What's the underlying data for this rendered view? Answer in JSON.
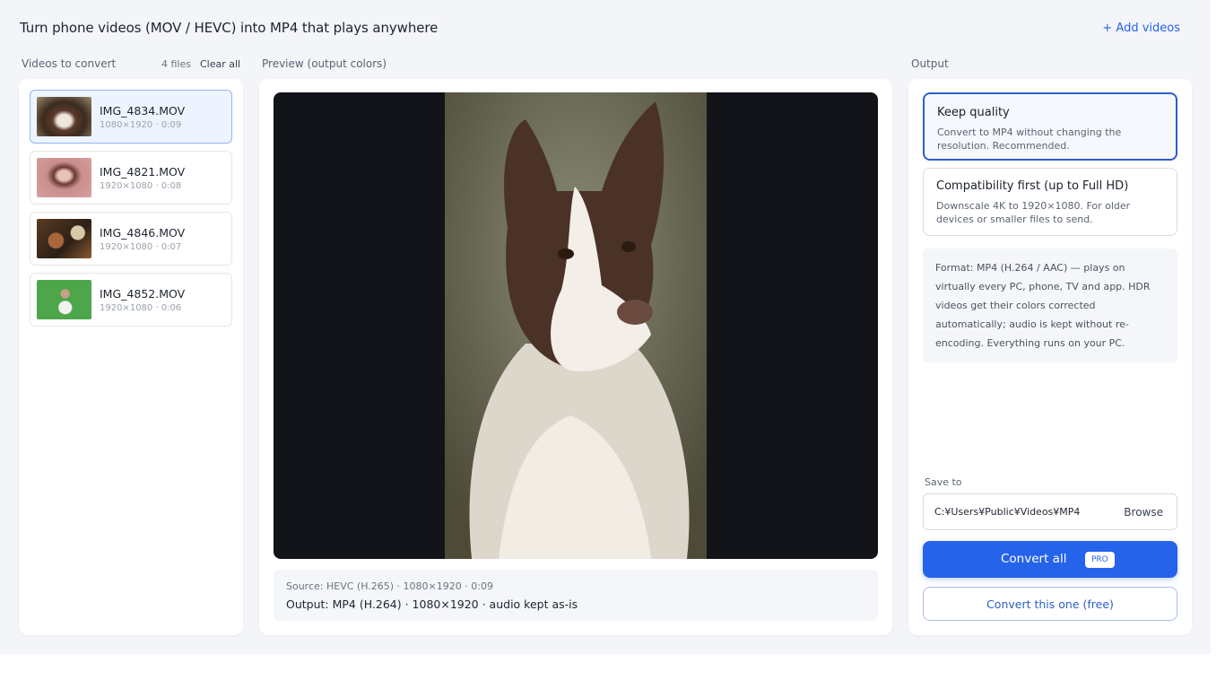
{
  "header": {
    "title": "Turn phone videos (MOV / HEVC) into MP4 that plays anywhere",
    "add_videos": "+ Add videos"
  },
  "videos": {
    "section_label": "Videos to convert",
    "count": "4 files",
    "clear_all": "Clear all",
    "items": [
      {
        "name": "IMG_4834.MOV",
        "meta": "1080×1920 · 0:09",
        "selected": true
      },
      {
        "name": "IMG_4821.MOV",
        "meta": "1920×1080 · 0:08",
        "selected": false
      },
      {
        "name": "IMG_4846.MOV",
        "meta": "1920×1080 · 0:07",
        "selected": false
      },
      {
        "name": "IMG_4852.MOV",
        "meta": "1920×1080 · 0:06",
        "selected": false
      }
    ]
  },
  "preview": {
    "section_label": "Preview (output colors)",
    "source": "Source: HEVC (H.265) · 1080×1920 · 0:09",
    "output": "Output: MP4 (H.264) · 1080×1920 · audio kept as-is"
  },
  "output": {
    "section_label": "Output",
    "options": [
      {
        "title": "Keep quality",
        "description": "Convert to MP4 without changing the resolution. Recommended.",
        "selected": true
      },
      {
        "title": "Compatibility first (up to Full HD)",
        "description": "Downscale 4K to 1920×1080. For older devices or smaller files to send.",
        "selected": false
      }
    ],
    "format_note": "Format: MP4 (H.264 / AAC) — plays on virtually every PC, phone, TV and app. HDR videos get their colors corrected automatically; audio is kept without re-encoding. Everything runs on your PC.",
    "save_label": "Save to",
    "save_path": "C:¥Users¥Public¥Videos¥MP4",
    "browse": "Browse",
    "convert_all": "Convert all",
    "pro_badge": "PRO",
    "convert_one": "Convert this one (free)"
  },
  "colors": {
    "accent": "#2563eb",
    "selected_border": "#2d5fc4",
    "background": "#f4f5f8"
  }
}
